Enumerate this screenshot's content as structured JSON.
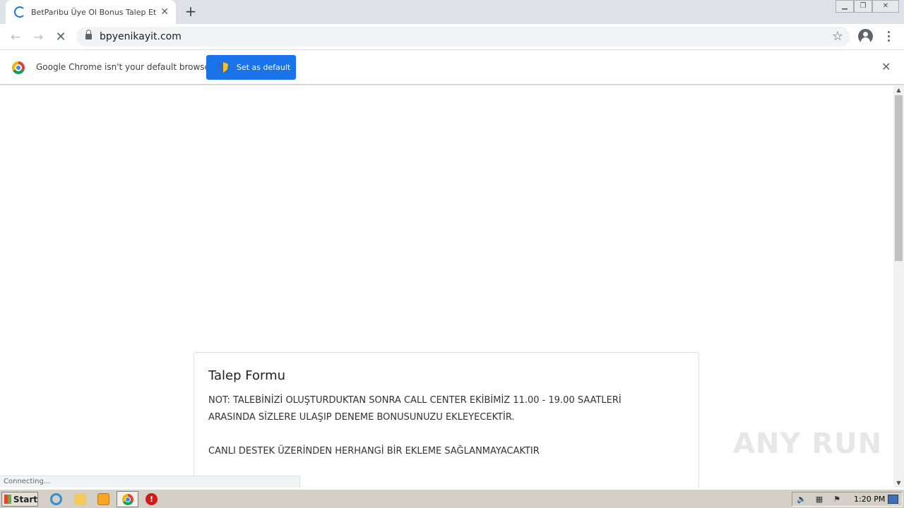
{
  "browser": {
    "tab": {
      "title": "BetParibu Üye Ol Bonus Talep Et",
      "close_icon": "close-icon"
    },
    "new_tab_label": "+",
    "address": {
      "url": "bpyenikayit.com"
    },
    "infobar": {
      "message": "Google Chrome isn't your default browser",
      "button_label": "Set as default",
      "close_label": "✕"
    },
    "status_text": "Connecting..."
  },
  "page": {
    "form_title": "Talep Formu",
    "note_line1": "NOT: TALEBİNİZİ OLUŞTURDUKTAN SONRA CALL CENTER EKİBİMİZ 11.00 - 19.00 SAATLERİ",
    "note_line2": "ARASINDA SİZLERE ULAŞIP DENEME BONUSUNUZU EKLEYECEKTİR.",
    "note_line3": "CANLI DESTEK ÜZERİNDEN HERHANGİ BİR EKLEME SAĞLANMAYACAKTIR"
  },
  "watermark": "ANY RUN",
  "taskbar": {
    "start_label": "Start",
    "clock": "1:20 PM"
  },
  "colors": {
    "accent": "#1a73e8",
    "tabstrip": "#dee1e6",
    "taskbar": "#d4d0c8"
  }
}
